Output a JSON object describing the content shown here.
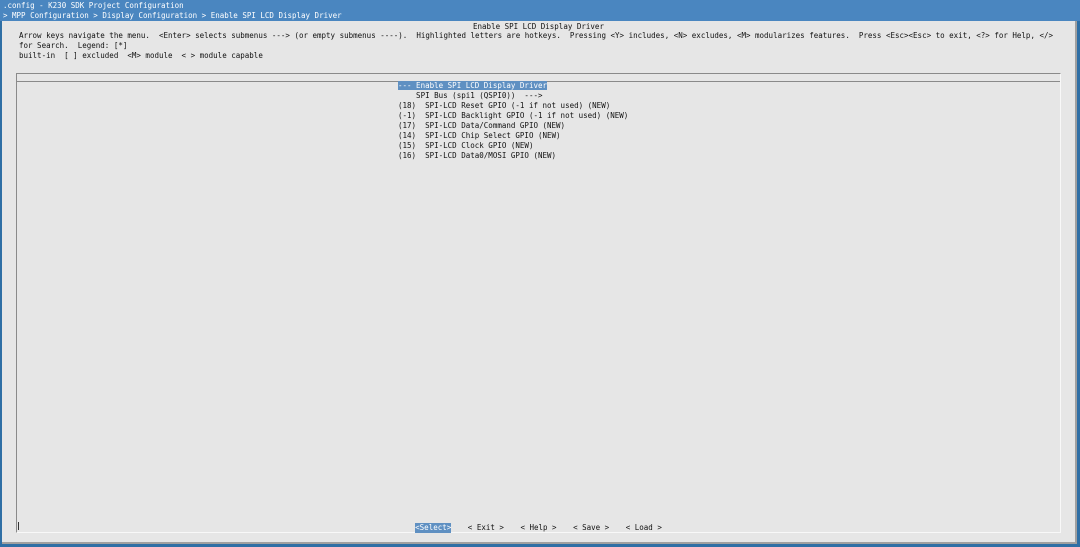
{
  "window": {
    "title": ".config - K230 SDK Project Configuration",
    "breadcrumb": "> MPP Configuration > Display Configuration > Enable SPI LCD Display Driver"
  },
  "dialog": {
    "title": "Enable SPI LCD Display Driver",
    "help": "Arrow keys navigate the menu.  <Enter> selects submenus ---> (or empty submenus ----).  Highlighted letters are hotkeys.  Pressing <Y> includes, <N> excludes, <M> modularizes features.  Press <Esc><Esc> to exit, <?> for Help, </> for Search.  Legend: [*]\nbuilt-in  [ ] excluded  <M> module  < > module capable"
  },
  "menu": {
    "items": [
      {
        "text": "--- Enable SPI LCD Display Driver",
        "selected": true
      },
      {
        "text": "    SPI Bus (spi1 (QSPI0))  --->",
        "selected": false
      },
      {
        "text": "(18)  SPI-LCD Reset GPIO (-1 if not used) (NEW)",
        "selected": false
      },
      {
        "text": "(-1)  SPI-LCD Backlight GPIO (-1 if not used) (NEW)",
        "selected": false
      },
      {
        "text": "(17)  SPI-LCD Data/Command GPIO (NEW)",
        "selected": false
      },
      {
        "text": "(14)  SPI-LCD Chip Select GPIO (NEW)",
        "selected": false
      },
      {
        "text": "(15)  SPI-LCD Clock GPIO (NEW)",
        "selected": false
      },
      {
        "text": "(16)  SPI-LCD Data0/MOSI GPIO (NEW)",
        "selected": false
      }
    ]
  },
  "buttons": {
    "select": "<Select>",
    "exit": "< Exit >",
    "help": "< Help >",
    "save": "< Save >",
    "load": "< Load >"
  },
  "colors": {
    "titlebar": "#4a86c0",
    "dialog_bg": "#e6e6e6",
    "highlight": "#5f90c2"
  }
}
